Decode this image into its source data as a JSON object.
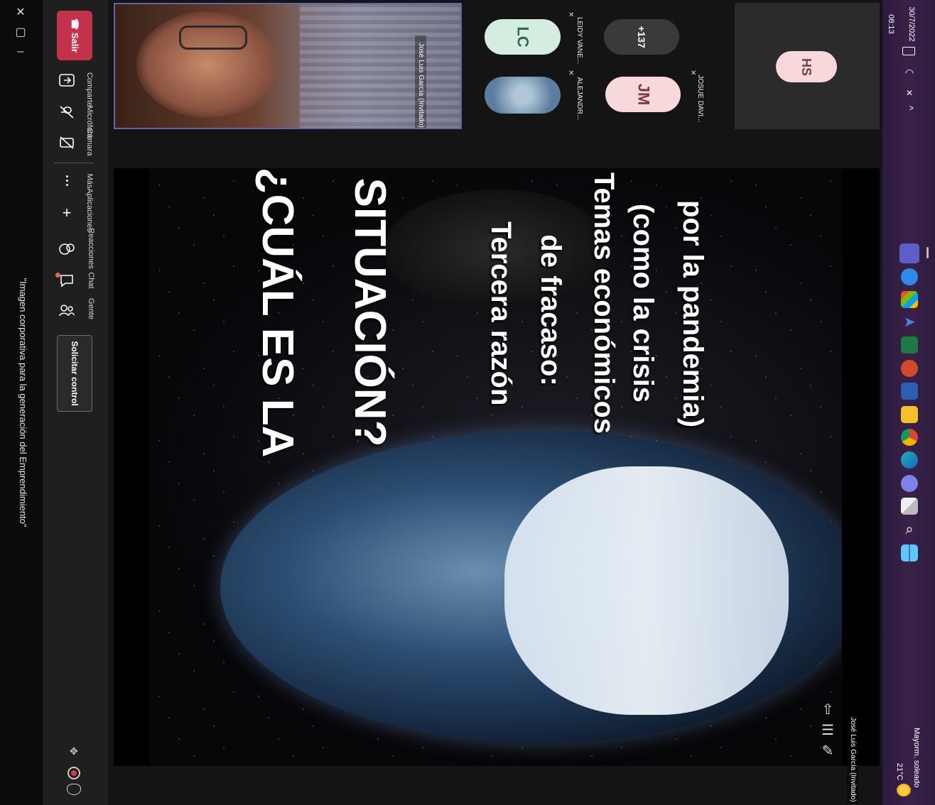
{
  "window": {
    "title": "\"Imagen corporativa para la generación del Emprendimiento\"",
    "controls": {
      "minimize": "–",
      "maximize": "▢",
      "close": "✕"
    }
  },
  "toolbar": {
    "leave_label": "Salir",
    "share_label": "Comparte",
    "mic_label": "Micrófono",
    "camera_label": "Cámara",
    "more_label": "Más",
    "apps_label": "Aplicaciones",
    "reactions_label": "Reacciones",
    "chat_label": "Chat",
    "people_label": "Gente",
    "request_control_label": "Solicitar control"
  },
  "slide": {
    "title_line1": "¿CUÁL ES LA",
    "title_line2": "SITUACIÓN?",
    "body_lines": [
      "Tercera razón",
      "de fracaso:",
      "Temas económicos",
      "(como la crisis",
      "por la pandemia)"
    ],
    "presenter_label": "José Luis García (Invitado)"
  },
  "participants": {
    "main_video_name": "José Luis García (Invitado)",
    "tiles": [
      {
        "initials": "LC",
        "name": "LEIDY VANE..."
      },
      {
        "initials": "",
        "name": "ALEJANDR..."
      },
      {
        "initials": "+137",
        "name": ""
      },
      {
        "initials": "JM",
        "name": "JOSUE DAVI..."
      },
      {
        "initials": "HS",
        "name": ""
      }
    ]
  },
  "taskbar": {
    "time": "08:13",
    "date": "30/7/2022",
    "weather_temp": "21°C",
    "weather_desc": "Mayorm. soleado",
    "chevron": "^"
  },
  "colors": {
    "leave_red": "#c4314b",
    "accent_purple": "#6264a7",
    "lc_avatar_bg": "#d5ece0",
    "jm_avatar_bg": "#f7d9dc",
    "hs_avatar_bg": "#f7d9dc",
    "plus_bg": "#3a3a3a"
  }
}
